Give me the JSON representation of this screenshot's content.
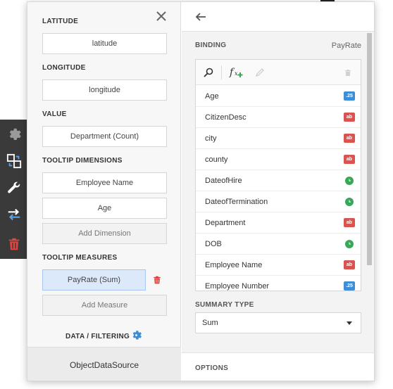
{
  "toolbar": {
    "items": [
      {
        "icon": "gear-icon",
        "color": "#9a9a9a"
      },
      {
        "icon": "binding-icon",
        "color": "#ffffff"
      },
      {
        "icon": "wrench-icon",
        "color": "#ffffff"
      },
      {
        "icon": "swap-icon",
        "color": "#ffffff"
      },
      {
        "icon": "trash-icon",
        "color": "#e0453f"
      }
    ]
  },
  "left": {
    "latitude_label": "LATITUDE",
    "latitude_value": "latitude",
    "longitude_label": "LONGITUDE",
    "longitude_value": "longitude",
    "value_label": "VALUE",
    "value_value": "Department (Count)",
    "tooltip_dimensions_label": "TOOLTIP DIMENSIONS",
    "tooltip_dimensions": [
      "Employee Name",
      "Age"
    ],
    "add_dimension": "Add Dimension",
    "tooltip_measures_label": "TOOLTIP MEASURES",
    "tooltip_measures": [
      "PayRate (Sum)"
    ],
    "add_measure": "Add Measure",
    "data_filtering_label": "DATA / FILTERING",
    "data_source": "ObjectDataSource"
  },
  "right": {
    "binding_label": "BINDING",
    "binding_value": "PayRate",
    "fields": [
      {
        "name": "Age",
        "type": "num",
        "badge": ".25"
      },
      {
        "name": "CitizenDesc",
        "type": "str",
        "badge": "ab"
      },
      {
        "name": "city",
        "type": "str",
        "badge": "ab"
      },
      {
        "name": "county",
        "type": "str",
        "badge": "ab"
      },
      {
        "name": "DateofHire",
        "type": "date",
        "badge": ""
      },
      {
        "name": "DateofTermination",
        "type": "date",
        "badge": ""
      },
      {
        "name": "Department",
        "type": "str",
        "badge": "ab"
      },
      {
        "name": "DOB",
        "type": "date",
        "badge": ""
      },
      {
        "name": "Employee Name",
        "type": "str",
        "badge": "ab"
      },
      {
        "name": "Employee Number",
        "type": "num",
        "badge": ".25"
      }
    ],
    "summary_type_label": "SUMMARY TYPE",
    "summary_type_value": "Sum",
    "options_label": "OPTIONS"
  },
  "colors": {
    "accent": "#3e8ed6",
    "selected_bg": "#dbe9fb",
    "string_badge": "#d9534f",
    "number_badge": "#3e8ed6",
    "date_badge": "#39a75a",
    "delete_red": "#e0453f",
    "toolbar_bg": "#3a3a3a"
  }
}
